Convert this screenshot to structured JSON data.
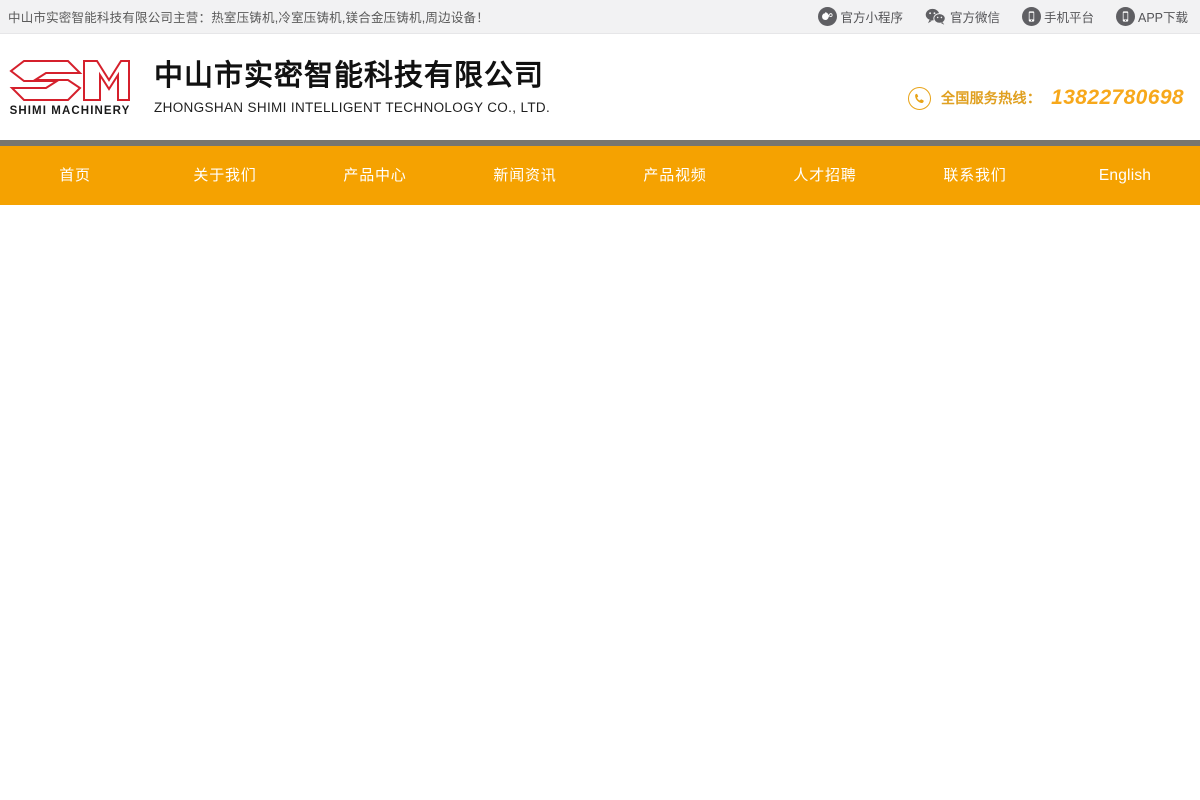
{
  "topbar": {
    "slogan": "中山市实密智能科技有限公司主营：热室压铸机,冷室压铸机,镁合金压铸机,周边设备！",
    "links": [
      {
        "label": "官方小程序",
        "icon": "mini-program-icon"
      },
      {
        "label": "官方微信",
        "icon": "wechat-icon"
      },
      {
        "label": "手机平台",
        "icon": "mobile-phone-icon"
      },
      {
        "label": "APP下载",
        "icon": "app-download-icon"
      }
    ]
  },
  "header": {
    "logo": {
      "mark_text": "SM",
      "sub_text": "SHIMI MACHINERY",
      "mark_color": "#d5202c"
    },
    "company_cn": "中山市实密智能科技有限公司",
    "company_en": "ZHONGSHAN SHIMI INTELLIGENT TECHNOLOGY CO., LTD.",
    "hotline_label": "全国服务热线：",
    "hotline_number": "13822780698",
    "hotline_color": "#f7a81b"
  },
  "nav": {
    "bar_color": "#f5a201",
    "top_line_color": "#77766f",
    "items": [
      {
        "label": "首页"
      },
      {
        "label": "关于我们"
      },
      {
        "label": "产品中心"
      },
      {
        "label": "新闻资讯"
      },
      {
        "label": "产品视频"
      },
      {
        "label": "人才招聘"
      },
      {
        "label": "联系我们"
      },
      {
        "label": "English"
      }
    ]
  }
}
